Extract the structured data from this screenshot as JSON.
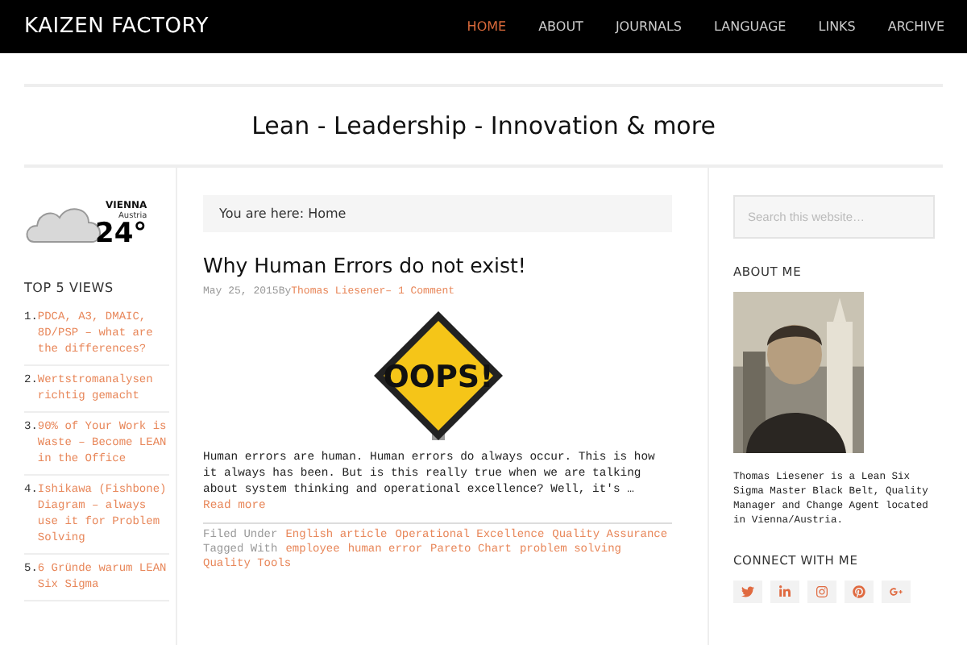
{
  "header": {
    "logo": "KAIZEN FACTORY",
    "nav": [
      {
        "label": "HOME",
        "selected": true
      },
      {
        "label": "ABOUT",
        "selected": false
      },
      {
        "label": "JOURNALS",
        "selected": false
      },
      {
        "label": "LANGUAGE",
        "selected": false
      },
      {
        "label": "LINKS",
        "selected": false
      },
      {
        "label": "ARCHIVE",
        "selected": false
      }
    ]
  },
  "tagline": "Lean - Leadership - Innovation & more",
  "left": {
    "weather": {
      "city": "VIENNA",
      "country": "Austria",
      "temperature": "24°"
    },
    "top_views": {
      "title": "TOP 5 VIEWS",
      "items": [
        {
          "number": "1.",
          "title": "PDCA, A3, DMAIC, 8D/PSP – what are the differences?"
        },
        {
          "number": "2.",
          "title": "Wertstromanalysen richtig gemacht"
        },
        {
          "number": "3.",
          "title": "90% of Your Work is Waste – Become LEAN in the Office"
        },
        {
          "number": "4.",
          "title": "Ishikawa (Fishbone) Diagram – always use it for Problem Solving"
        },
        {
          "number": "5.",
          "title": "6 Gründe warum LEAN Six Sigma"
        }
      ]
    }
  },
  "main": {
    "breadcrumb": "You are here: Home",
    "post": {
      "title": "Why Human Errors do not exist!",
      "date": "May 25, 2015",
      "by": "By",
      "author": "Thomas Liesener",
      "comments": "– 1 Comment",
      "image_text": "OOPS!",
      "excerpt": "Human errors are human. Human errors do always occur. This is how it always has been. But is this really true when we are talking about system thinking and operational excellence? Well, it's …",
      "read_more": "Read more",
      "filed_label": "Filed Under",
      "categories": [
        "English article",
        "Operational Excellence",
        "Quality Assurance"
      ],
      "tagged_label": "Tagged With",
      "tags": [
        "employee",
        "human error",
        "Pareto Chart",
        "problem solving",
        "Quality Tools"
      ]
    }
  },
  "right": {
    "search": {
      "placeholder": "Search this website…"
    },
    "about_title": "ABOUT ME",
    "bio": "Thomas Liesener is a Lean Six Sigma Master Black Belt, Quality Manager and Change Agent located in Vienna/Austria.",
    "connect_title": "CONNECT WITH ME",
    "social": [
      {
        "kind": "twitter"
      },
      {
        "kind": "linkedin"
      },
      {
        "kind": "instagram"
      },
      {
        "kind": "pinterest"
      },
      {
        "kind": "googleplus"
      }
    ]
  }
}
